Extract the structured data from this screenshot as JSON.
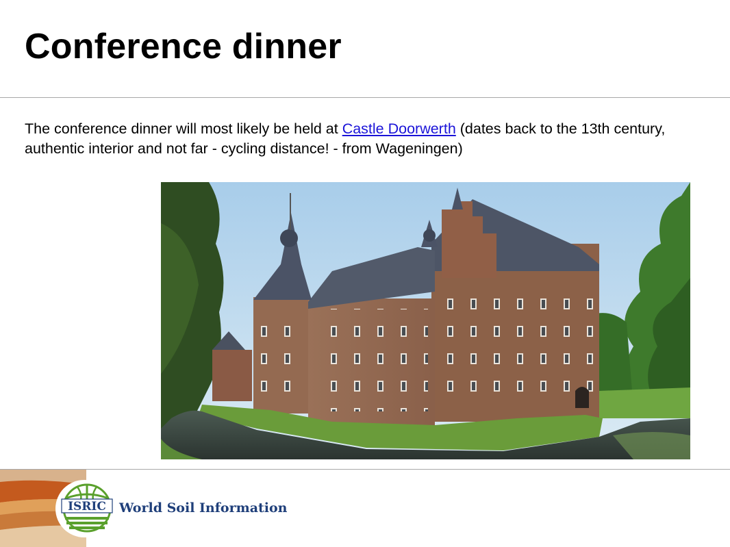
{
  "slide": {
    "title": "Conference dinner",
    "body": {
      "text_before": "The conference dinner will most likely be held at ",
      "link_text": "Castle Doorwerth",
      "text_after": " (dates back to the 13th century, authentic interior and not far - cycling distance! - from Wageningen)"
    }
  },
  "footer": {
    "logo_text": "ISRIC",
    "tagline": "World Soil Information"
  },
  "colors": {
    "link": "#1a13d8",
    "rule": "#a8a8a8",
    "logo_green": "#5aa02c",
    "tagline": "#1f3f7a"
  }
}
